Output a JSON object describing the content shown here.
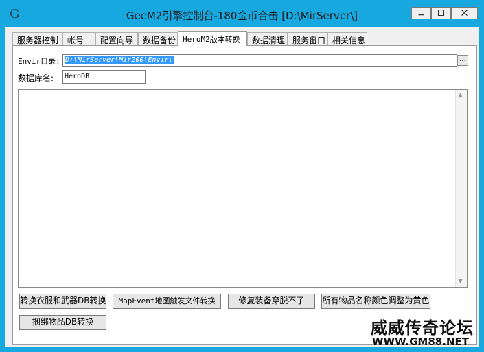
{
  "window": {
    "title": "GeeM2引擎控制台-180金币合击 [D:\\MirServer\\]",
    "app_icon": "G",
    "controls": [
      "minimize-icon",
      "maximize-icon",
      "close-icon"
    ]
  },
  "tabs": [
    {
      "label": "服务器控制"
    },
    {
      "label": "帐号"
    },
    {
      "label": "配置向导"
    },
    {
      "label": "数据备份"
    },
    {
      "label": "HeroM2版本转换",
      "active": true
    },
    {
      "label": "数据清理"
    },
    {
      "label": "服务窗口"
    },
    {
      "label": "相关信息"
    }
  ],
  "form": {
    "envir_label": "Envir目录:",
    "envir_value": "D:\\MirServer\\Mir200\\Envir\\",
    "browse_label": "...",
    "db_label": "数据库名:",
    "db_value": "HeroDB"
  },
  "log": {
    "content": ""
  },
  "buttons": {
    "convert_clothes_weapons": "转换衣服和武器DB转换",
    "mapevent_convert": "MapEvent地图触发文件转换",
    "fix_equip": "修复装备穿脱不了",
    "item_color_yellow": "所有物品名称颜色调整为黄色",
    "bind_items_convert": "捆绑物品DB转换"
  },
  "watermark": {
    "title": "威威传奇论坛",
    "url": "WWW.GM88.NET"
  }
}
